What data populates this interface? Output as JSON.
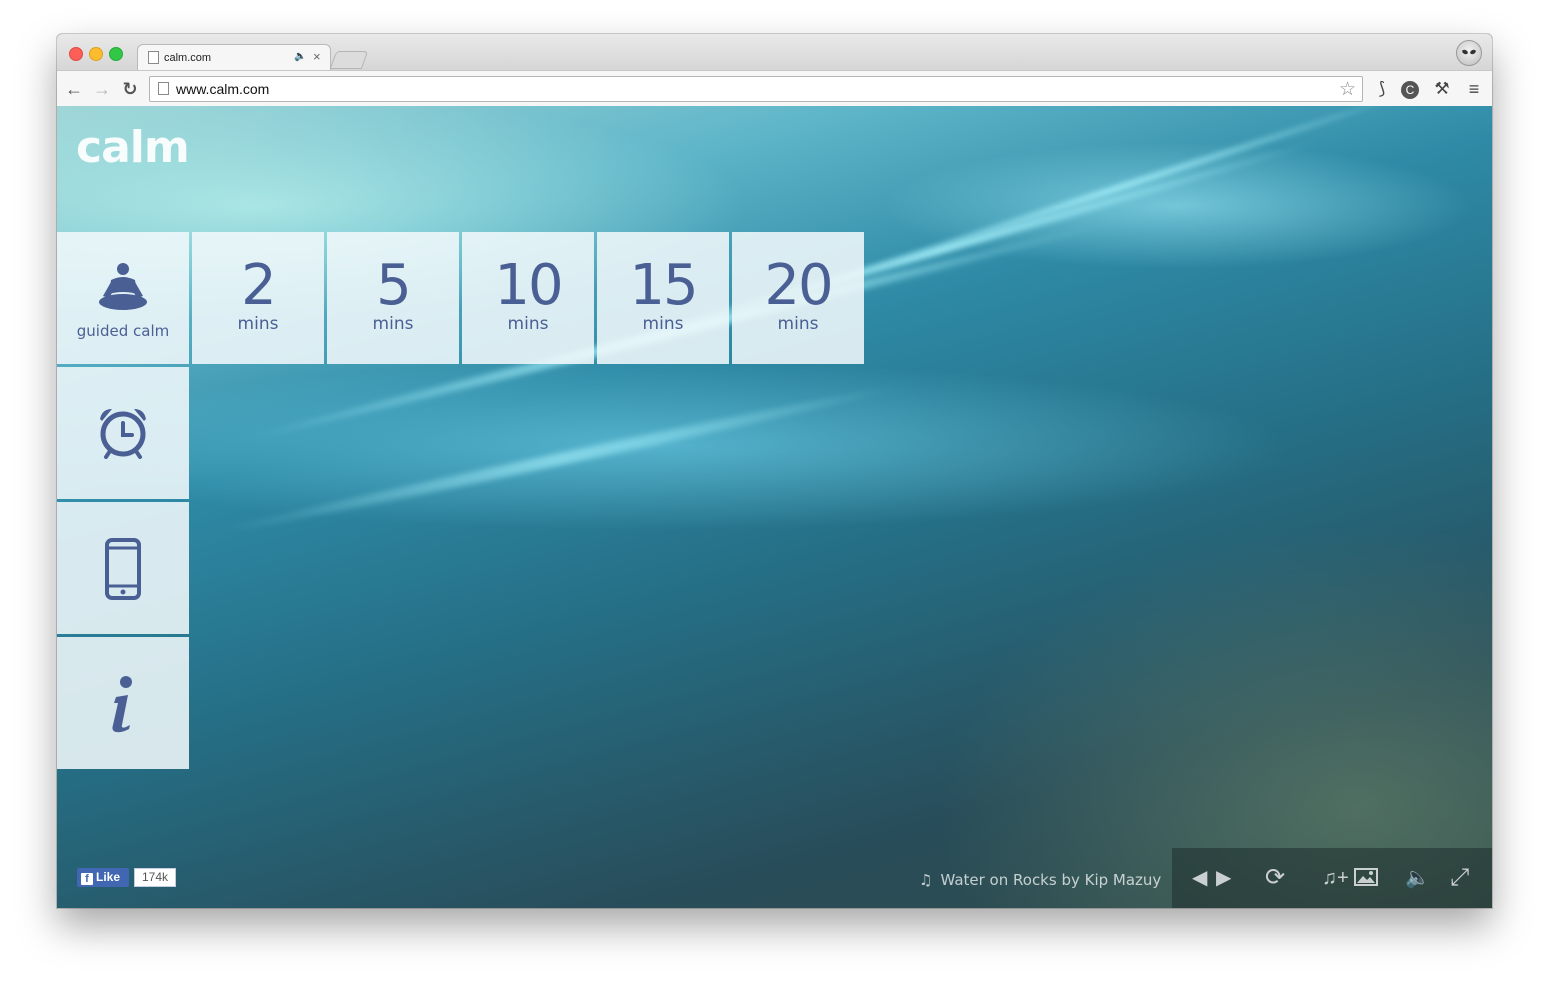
{
  "browser": {
    "tab_title": "calm.com",
    "tab_audio_icon": "speaker-icon",
    "tab_close": "×",
    "url": "www.calm.com",
    "nav": {
      "back": "←",
      "forward": "→",
      "reload": "↻"
    },
    "bookmark": "☆",
    "extensions": [
      "leaf-icon",
      "c-extension-icon",
      "wrench-icon",
      "menu-icon"
    ],
    "extension_glyphs": [
      "⟆",
      "C",
      "⚒",
      "≡"
    ]
  },
  "app": {
    "logo": "calm",
    "guided_label": "guided calm",
    "timers": [
      {
        "value": "2",
        "unit": "mins"
      },
      {
        "value": "5",
        "unit": "mins"
      },
      {
        "value": "10",
        "unit": "mins"
      },
      {
        "value": "15",
        "unit": "mins"
      },
      {
        "value": "20",
        "unit": "mins"
      }
    ],
    "side_tiles": [
      "alarm-clock-icon",
      "phone-icon",
      "info-icon"
    ],
    "facebook": {
      "like_label": "Like",
      "count": "174k"
    },
    "now_playing": "Water on Rocks by Kip Mazuy",
    "controls": {
      "prev": "◀",
      "next": "▶",
      "repeat": "⟳",
      "music_scene": "♫+",
      "volume": "🔈",
      "fullscreen": "⤢"
    }
  },
  "colors": {
    "tile_text": "#4a5f94",
    "tile_bg": "#eef6f8"
  }
}
